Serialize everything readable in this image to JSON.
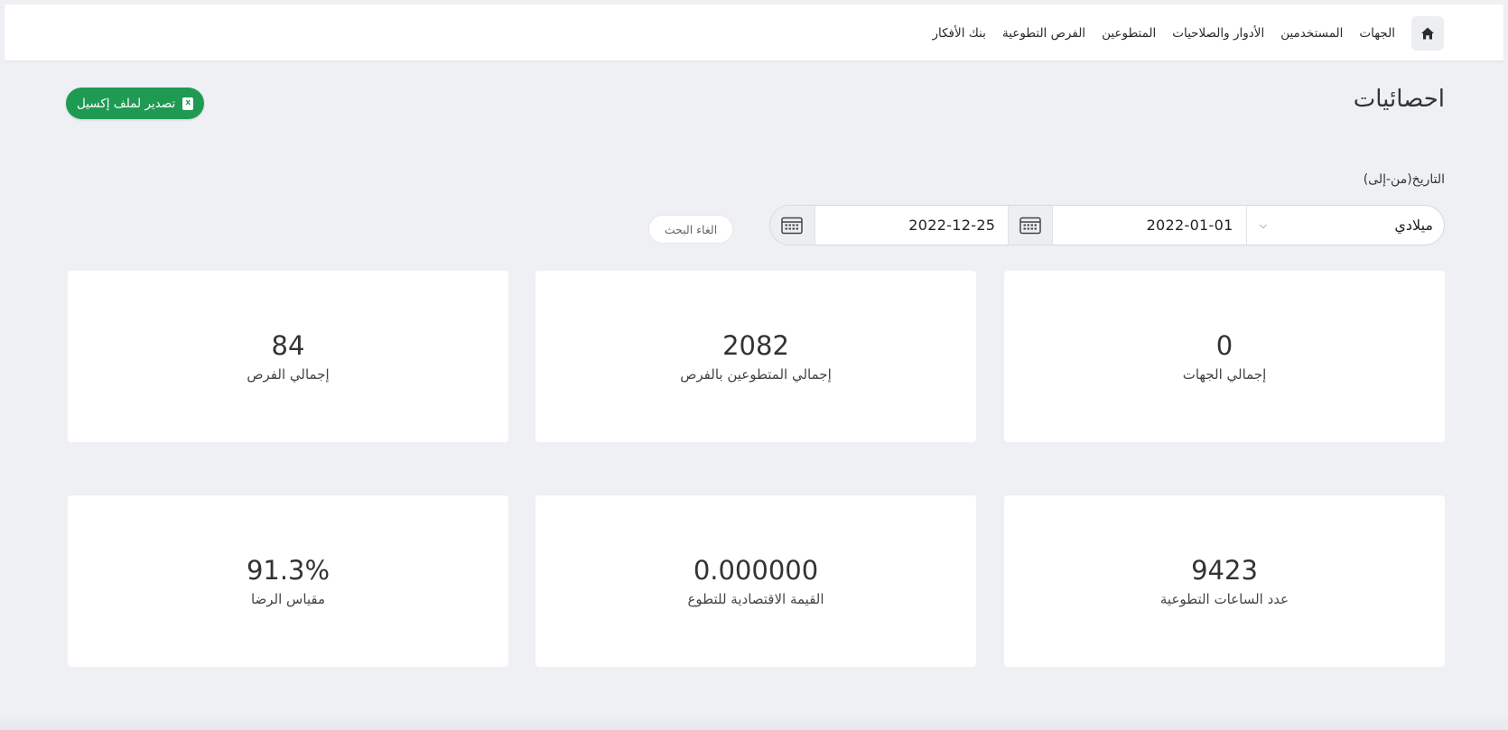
{
  "nav": {
    "home_icon": "home-icon",
    "items": [
      {
        "label": "الجهات"
      },
      {
        "label": "المستخدمين"
      },
      {
        "label": "الأدوار والصلاحيات"
      },
      {
        "label": "المتطوعين"
      },
      {
        "label": "الفرص التطوعية"
      },
      {
        "label": "بنك الأفكار"
      }
    ]
  },
  "header": {
    "title": "احصائيات",
    "export_label": "تصدير لملف إكسيل",
    "export_icon": "excel-file-icon"
  },
  "filter": {
    "date_label": "التاريخ(من-إلى)",
    "calendar_type": "ميلادي",
    "date_from": "2022-01-01",
    "date_to": "2022-12-25",
    "cancel_label": "الغاء البحث",
    "calendar_icon": "calendar-icon"
  },
  "stats": [
    {
      "value": "0",
      "label": "إجمالي الجهات"
    },
    {
      "value": "2082",
      "label": "إجمالي المتطوعين بالفرص"
    },
    {
      "value": "84",
      "label": "إجمالي الفرص"
    },
    {
      "value": "9423",
      "label": "عدد الساعات التطوعية"
    },
    {
      "value": "0.000000",
      "label": "القيمة الاقتصادية للتطوع"
    },
    {
      "value": "91.3%",
      "label": "مقياس الرضا"
    }
  ],
  "colors": {
    "accent_green": "#1e9a52",
    "background": "#eef0f4",
    "card": "#ffffff"
  }
}
